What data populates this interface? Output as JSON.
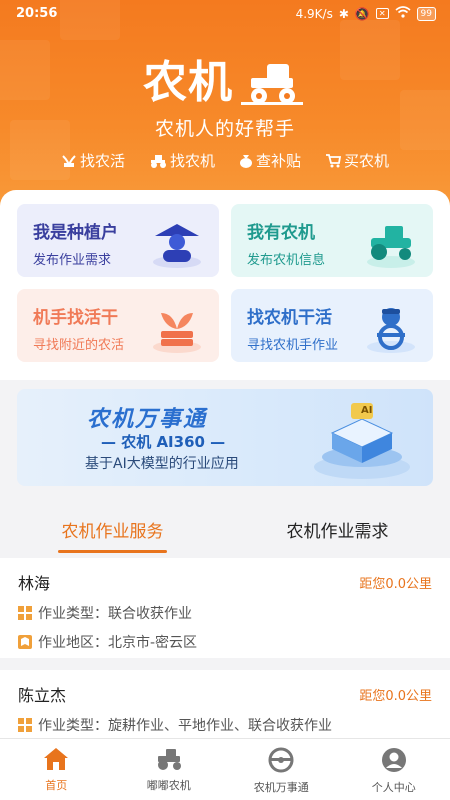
{
  "status": {
    "time": "20:56",
    "speed": "4.9K/s",
    "battery": "99"
  },
  "brand": {
    "title": "农机",
    "slogan": "农机人的好帮手"
  },
  "quicknav": [
    {
      "label": "找农活",
      "icon": "crop-icon"
    },
    {
      "label": "找农机",
      "icon": "tractor-icon"
    },
    {
      "label": "查补贴",
      "icon": "money-bag-icon"
    },
    {
      "label": "买农机",
      "icon": "cart-icon"
    }
  ],
  "tiles": [
    {
      "title": "我是种植户",
      "sub": "发布作业需求",
      "icon": "farmer-icon",
      "bg": "#eceefb",
      "color": "#3a3f9e"
    },
    {
      "title": "我有农机",
      "sub": "发布农机信息",
      "icon": "tractor-icon",
      "bg": "#e4f7f5",
      "color": "#1f9a8e"
    },
    {
      "title": "机手找活干",
      "sub": "寻找附近的农活",
      "icon": "crop-icon",
      "bg": "#fdeee9",
      "color": "#f07a57"
    },
    {
      "title": "找农机干活",
      "sub": "寻找农机手作业",
      "icon": "driver-icon",
      "bg": "#e8f1fd",
      "color": "#2f6fc9"
    }
  ],
  "banner": {
    "title": "农机万事通",
    "subtitle": "— 农机 AI360 —",
    "desc": "基于AI大模型的行业应用",
    "chip": "AI"
  },
  "tabs": [
    {
      "label": "农机作业服务",
      "active": true
    },
    {
      "label": "农机作业需求",
      "active": false
    }
  ],
  "list": [
    {
      "name": "林海",
      "distance": "距您0.0公里",
      "type": "作业类型：联合收获作业",
      "area": "作业地区：北京市-密云区"
    },
    {
      "name": "陈立杰",
      "distance": "距您0.0公里",
      "type": "作业类型：旋耕作业、平地作业、联合收获作业"
    }
  ],
  "tabbar": [
    {
      "label": "首页",
      "icon": "home-icon",
      "active": true
    },
    {
      "label": "嘟嘟农机",
      "icon": "tractor-icon",
      "active": false
    },
    {
      "label": "农机万事通",
      "icon": "steering-wheel-icon",
      "active": false
    },
    {
      "label": "个人中心",
      "icon": "person-icon",
      "active": false
    }
  ],
  "colors": {
    "accent": "#e8741d",
    "hero": "#f47a1f"
  }
}
